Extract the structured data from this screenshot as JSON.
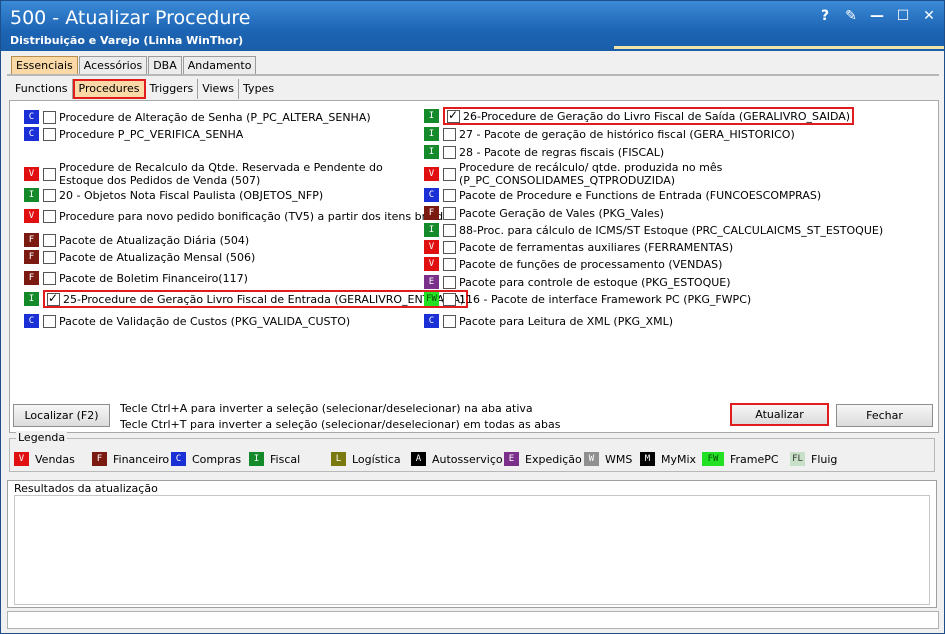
{
  "window": {
    "title": "500 - Atualizar Procedure",
    "subtitle": "Distribuição e Varejo (Linha WinThor)",
    "controls": [
      "?",
      "✎",
      "—",
      "☐",
      "✕"
    ]
  },
  "colors": {
    "V": "#e01010",
    "F": "#7a1a10",
    "C": "#1a2fd6",
    "I": "#158a2a",
    "L": "#7a7a10",
    "A": "#000000",
    "E": "#7a2f8a",
    "W": "#909090",
    "M": "#000000",
    "FW": "#22e022",
    "FL": "#c8e0c8"
  },
  "tabs_top": [
    "Essenciais",
    "Acessórios",
    "DBA",
    "Andamento"
  ],
  "tabs_sub": [
    "Functions",
    "Procedures",
    "Triggers",
    "Views",
    "Types"
  ],
  "left_items": [
    {
      "badge": "C",
      "checked": false,
      "label": "Procedure de Alteração de Senha (P_PC_ALTERA_SENHA)"
    },
    {
      "badge": "C",
      "checked": false,
      "label": "Procedure P_PC_VERIFICA_SENHA"
    },
    {
      "badge": "V",
      "checked": false,
      "label": "Procedure de Recalculo da Qtde. Reservada e Pendente do Estoque dos Pedidos de Venda (507)"
    },
    {
      "badge": "I",
      "checked": false,
      "label": "20 - Objetos Nota Fiscal Paulista (OBJETOS_NFP)"
    },
    {
      "badge": "V",
      "checked": false,
      "label": "Procedure para novo pedido bonificação (TV5) a partir dos itens brindes"
    },
    {
      "badge": "F",
      "checked": false,
      "label": "Pacote de Atualização Diária (504)"
    },
    {
      "badge": "F",
      "checked": false,
      "label": "Pacote de Atualização Mensal (506)"
    },
    {
      "badge": "F",
      "checked": false,
      "label": "Pacote de Boletim Financeiro(117)"
    },
    {
      "badge": "I",
      "checked": true,
      "label": "25-Procedure de Geração Livro Fiscal de Entrada (GERALIVRO_ENTRADA)"
    },
    {
      "badge": "C",
      "checked": false,
      "label": "Pacote de Validação de Custos (PKG_VALIDA_CUSTO)"
    }
  ],
  "right_items": [
    {
      "badge": "I",
      "checked": true,
      "label": "26-Procedure de Geração do Livro Fiscal de Saída (GERALIVRO_SAIDA)"
    },
    {
      "badge": "I",
      "checked": false,
      "label": "27 - Pacote de geração de histórico fiscal (GERA_HISTORICO)"
    },
    {
      "badge": "I",
      "checked": false,
      "label": "28 - Pacote de regras fiscais (FISCAL)"
    },
    {
      "badge": "V",
      "checked": false,
      "label": "Procedure de recálculo/ qtde. produzida no mês (P_PC_CONSOLIDAMES_QTPRODUZIDA)"
    },
    {
      "badge": "C",
      "checked": false,
      "label": "Pacote de Procedure e Functions de Entrada (FUNCOESCOMPRAS)"
    },
    {
      "badge": "F",
      "checked": false,
      "label": "Pacote Geração de Vales (PKG_Vales)"
    },
    {
      "badge": "I",
      "checked": false,
      "label": "88-Proc. para cálculo de ICMS/ST Estoque (PRC_CALCULAICMS_ST_ESTOQUE)"
    },
    {
      "badge": "V",
      "checked": false,
      "label": "Pacote de ferramentas auxiliares (FERRAMENTAS)"
    },
    {
      "badge": "V",
      "checked": false,
      "label": "Pacote de funções de processamento (VENDAS)"
    },
    {
      "badge": "E",
      "checked": false,
      "label": "Pacote para controle de estoque (PKG_ESTOQUE)"
    },
    {
      "badge": "FW",
      "checked": false,
      "label": "116 - Pacote de interface Framework PC (PKG_FWPC)"
    },
    {
      "badge": "C",
      "checked": false,
      "label": "Pacote para Leitura de XML (PKG_XML)"
    }
  ],
  "buttons": {
    "localizar": "Localizar (F2)",
    "atualizar": "Atualizar",
    "fechar": "Fechar"
  },
  "hints": [
    "Tecle Ctrl+A para inverter a seleção (selecionar/deselecionar) na aba ativa",
    "Tecle Ctrl+T para inverter a seleção (selecionar/deselecionar) em todas as abas"
  ],
  "legend": {
    "title": "Legenda",
    "items": [
      {
        "badge": "V",
        "label": "Vendas"
      },
      {
        "badge": "F",
        "label": "Financeiro"
      },
      {
        "badge": "C",
        "label": "Compras"
      },
      {
        "badge": "I",
        "label": "Fiscal"
      },
      {
        "badge": "L",
        "label": "Logística"
      },
      {
        "badge": "A",
        "label": "Autosserviço"
      },
      {
        "badge": "E",
        "label": "Expedição"
      },
      {
        "badge": "W",
        "label": "WMS"
      },
      {
        "badge": "M",
        "label": "MyMix"
      },
      {
        "badge": "FW",
        "label": "FramePC"
      },
      {
        "badge": "FL",
        "label": "Fluig"
      }
    ]
  },
  "results": {
    "title": "Resultados da atualização"
  }
}
